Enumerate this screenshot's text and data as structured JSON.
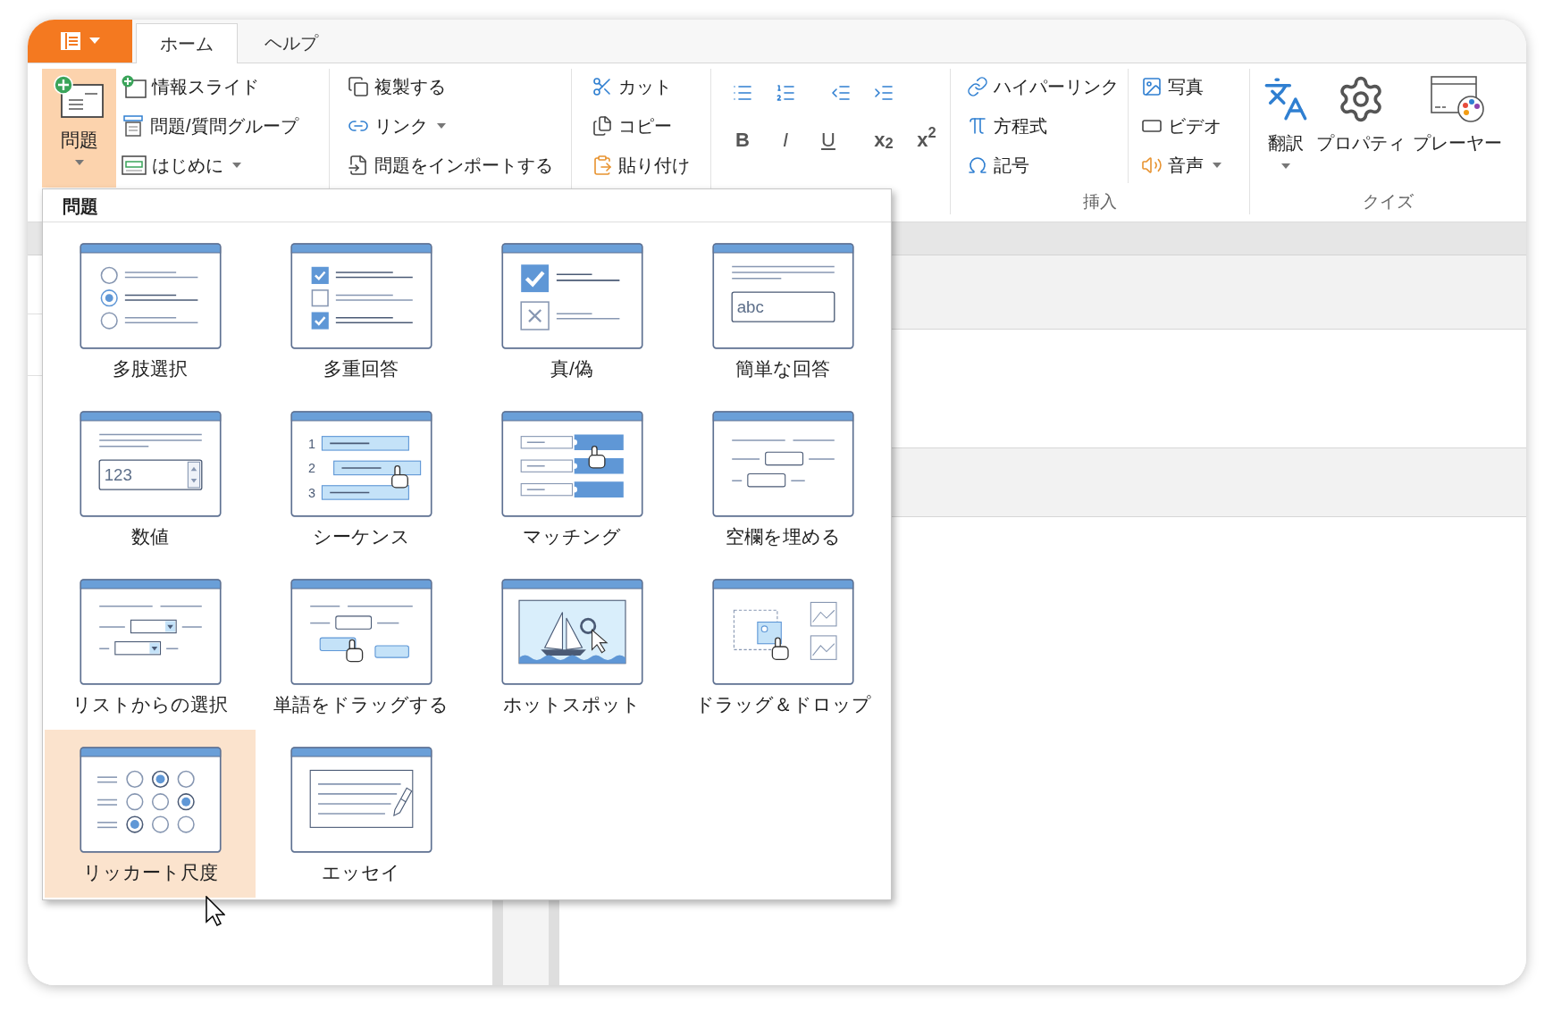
{
  "tabs": [
    {
      "label": "ホーム",
      "selected": true
    },
    {
      "label": "ヘルプ",
      "selected": false
    }
  ],
  "ribbon": {
    "question_button": {
      "label": "問題",
      "selected": true,
      "dropdown": true
    },
    "slide_items": [
      {
        "label": "情報スライド",
        "dropdown": false
      },
      {
        "label": "問題/質問グループ",
        "dropdown": false
      },
      {
        "label": "はじめに",
        "dropdown": true
      }
    ],
    "edit_items": [
      {
        "label": "複製する",
        "dropdown": false
      },
      {
        "label": "リンク",
        "dropdown": true
      },
      {
        "label": "問題をインポートする",
        "dropdown": false
      }
    ],
    "clipboard_items": [
      {
        "label": "カット"
      },
      {
        "label": "コピー"
      },
      {
        "label": "貼り付け"
      }
    ],
    "format_buttons": [
      {
        "label": "B",
        "kind": "bold"
      },
      {
        "label": "I",
        "kind": "italic"
      },
      {
        "label": "U",
        "kind": "underline"
      },
      {
        "label": "x$_{2}$",
        "kind": "script"
      },
      {
        "label": "x$^{2}$",
        "kind": "script"
      }
    ],
    "insert_group": {
      "label": "挿入",
      "items": [
        {
          "label": "ハイパーリンク",
          "dropdown": false
        },
        {
          "label": "方程式",
          "dropdown": false
        },
        {
          "label": "記号",
          "dropdown": false
        },
        {
          "label": "写真",
          "dropdown": false
        },
        {
          "label": "ビデオ",
          "dropdown": false
        },
        {
          "label": "音声",
          "dropdown": true
        }
      ]
    },
    "quiz_group": {
      "label": "クイズ",
      "items": [
        {
          "label": "翻訳",
          "dropdown": true
        },
        {
          "label": "プロパティ",
          "dropdown": false
        },
        {
          "label": "プレーヤー",
          "dropdown": false
        }
      ]
    }
  },
  "question_menu": {
    "title": "問題",
    "items": [
      {
        "label": "多肢選択",
        "kind": "radio",
        "selected": false
      },
      {
        "label": "多重回答",
        "kind": "checkbox",
        "selected": false
      },
      {
        "label": "真/偽",
        "kind": "truefalse",
        "selected": false
      },
      {
        "label": "簡単な回答",
        "kind": "text",
        "selected": false,
        "icon_text": [
          "abc"
        ]
      },
      {
        "label": "数値",
        "kind": "number",
        "selected": false,
        "icon_text": [
          "123"
        ]
      },
      {
        "label": "シーケンス",
        "kind": "sequence",
        "selected": false,
        "icon_text": [
          "1",
          "2",
          "3"
        ]
      },
      {
        "label": "マッチング",
        "kind": "matching",
        "selected": false
      },
      {
        "label": "空欄を埋める",
        "kind": "fillblank",
        "selected": false
      },
      {
        "label": "リストからの選択",
        "kind": "dropdown",
        "selected": false
      },
      {
        "label": "単語をドラッグする",
        "kind": "dragwords",
        "selected": false
      },
      {
        "label": "ホットスポット",
        "kind": "hotspot",
        "selected": false
      },
      {
        "label": "ドラッグ＆ドロップ",
        "kind": "dragdrop",
        "selected": false
      },
      {
        "label": "リッカート尺度",
        "kind": "likert",
        "selected": true
      },
      {
        "label": "エッセイ",
        "kind": "essay",
        "selected": false
      }
    ]
  }
}
